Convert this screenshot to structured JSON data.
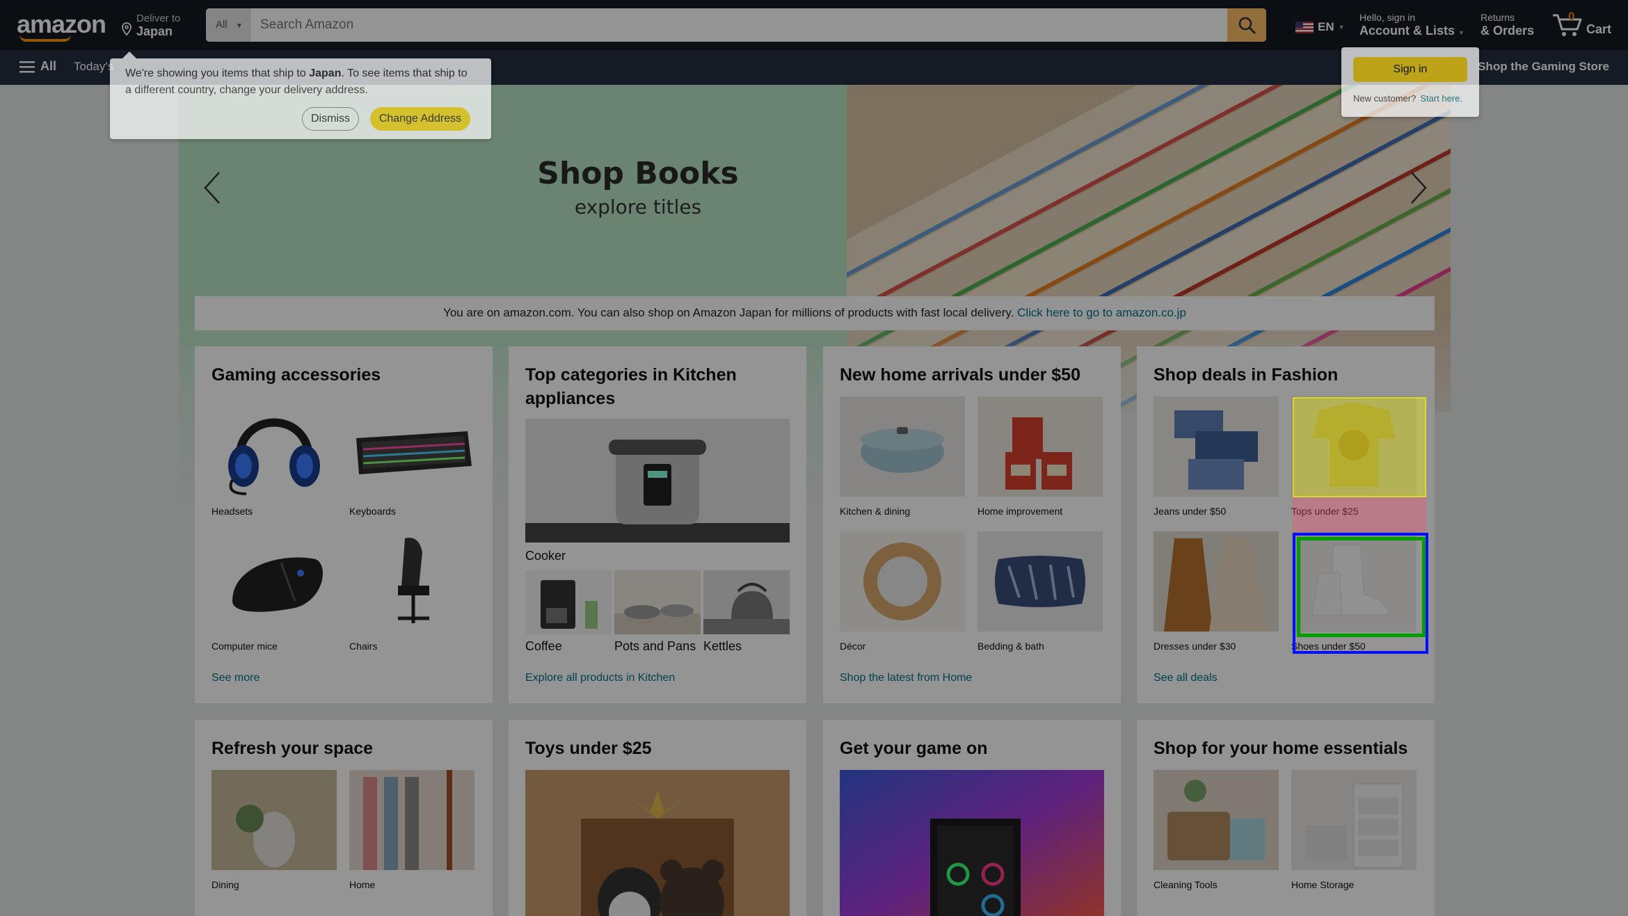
{
  "header": {
    "logo_text": "amazon",
    "deliver_line1": "Deliver to",
    "deliver_line2": "Japan",
    "search_category": "All",
    "search_placeholder": "Search Amazon",
    "language": "EN",
    "account_line1": "Hello, sign in",
    "account_line2": "Account & Lists",
    "returns_line1": "Returns",
    "returns_line2": "& Orders",
    "cart_count": "0",
    "cart_label": "Cart"
  },
  "nav": {
    "all_label": "All",
    "today_label": "Today's",
    "gaming_store_label": "Shop the Gaming Store"
  },
  "popover": {
    "message_pre": "We're showing you items that ship to ",
    "message_country": "Japan",
    "message_post": ". To see items that ship to a different country, change your delivery address.",
    "dismiss_label": "Dismiss",
    "change_label": "Change Address"
  },
  "signin_popover": {
    "button_label": "Sign in",
    "new_customer": "New customer?",
    "start_here": "Start here."
  },
  "hero": {
    "title": "Shop Books",
    "subtitle": "explore titles"
  },
  "notice": {
    "text": "You are on amazon.com. You can also shop on Amazon Japan for millions of products with fast local delivery.",
    "link": "Click here to go to amazon.co.jp"
  },
  "cards": {
    "gaming": {
      "title": "Gaming accessories",
      "items": [
        "Headsets",
        "Keyboards",
        "Computer mice",
        "Chairs"
      ],
      "link": "See more"
    },
    "kitchen": {
      "title": "Top categories in Kitchen appliances",
      "main_item": "Cooker",
      "items": [
        "Coffee",
        "Pots and Pans",
        "Kettles"
      ],
      "link": "Explore all products in Kitchen"
    },
    "home": {
      "title": "New home arrivals under $50",
      "items": [
        "Kitchen & dining",
        "Home improvement",
        "Décor",
        "Bedding & bath"
      ],
      "link": "Shop the latest from Home"
    },
    "fashion": {
      "title": "Shop deals in Fashion",
      "items": [
        "Jeans under $50",
        "Tops under $25",
        "Dresses under $30",
        "Shoes under $50"
      ],
      "link": "See all deals"
    },
    "refresh": {
      "title": "Refresh your space",
      "items": [
        "Dining",
        "Home"
      ]
    },
    "toys": {
      "title": "Toys under $25"
    },
    "game": {
      "title": "Get your game on"
    },
    "essentials": {
      "title": "Shop for your home essentials",
      "items": [
        "Cleaning Tools",
        "Home Storage"
      ]
    }
  },
  "colors": {
    "header_bg": "#131921",
    "nav_bg": "#232f3e",
    "accent": "#febd69",
    "button_yellow": "#ffd814",
    "link": "#007185"
  }
}
